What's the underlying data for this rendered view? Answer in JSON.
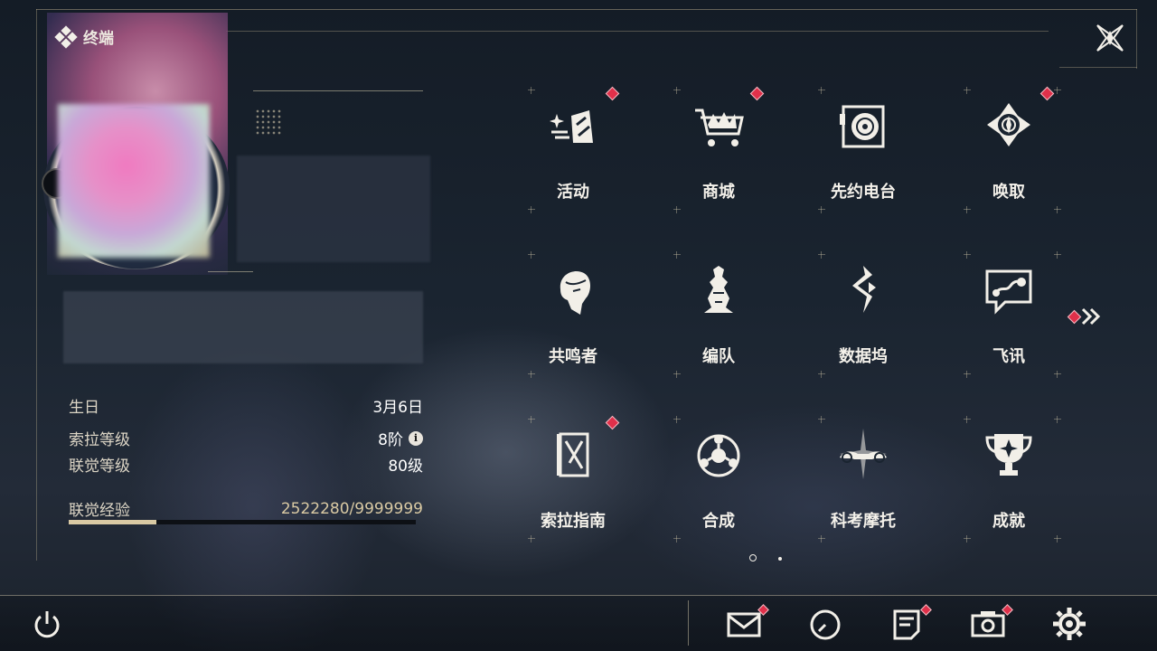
{
  "header": {
    "title": "终端"
  },
  "profile": {
    "birthday_label": "生日",
    "birthday_value": "3月6日",
    "sola_level_label": "索拉等级",
    "sola_level_value": "8阶",
    "union_level_label": "联觉等级",
    "union_level_value": "80级",
    "union_exp_label": "联觉经验",
    "union_exp_value": "2522280/9999999",
    "union_exp_fraction": 0.2522
  },
  "menu": {
    "items": [
      {
        "label": "活动",
        "icon": "activity-icon",
        "badge": true
      },
      {
        "label": "商城",
        "icon": "shop-icon",
        "badge": true
      },
      {
        "label": "先约电台",
        "icon": "radio-icon",
        "badge": false
      },
      {
        "label": "唤取",
        "icon": "convene-icon",
        "badge": true
      },
      {
        "label": "共鸣者",
        "icon": "resonator-icon",
        "badge": false
      },
      {
        "label": "编队",
        "icon": "team-icon",
        "badge": false
      },
      {
        "label": "数据坞",
        "icon": "data-bank-icon",
        "badge": false
      },
      {
        "label": "飞讯",
        "icon": "message-icon",
        "badge": false
      },
      {
        "label": "索拉指南",
        "icon": "guidebook-icon",
        "badge": true
      },
      {
        "label": "合成",
        "icon": "synthesis-icon",
        "badge": false
      },
      {
        "label": "科考摩托",
        "icon": "motorcycle-icon",
        "badge": false
      },
      {
        "label": "成就",
        "icon": "trophy-icon",
        "badge": false
      }
    ],
    "page_count": 2,
    "current_page": 1
  },
  "bottom_bar": {
    "icons": [
      "power-icon",
      "mail-icon",
      "clock-icon",
      "notice-icon",
      "camera-icon",
      "settings-icon"
    ]
  },
  "colors": {
    "badge": "#e0304a",
    "accent": "#d9c9a3"
  }
}
